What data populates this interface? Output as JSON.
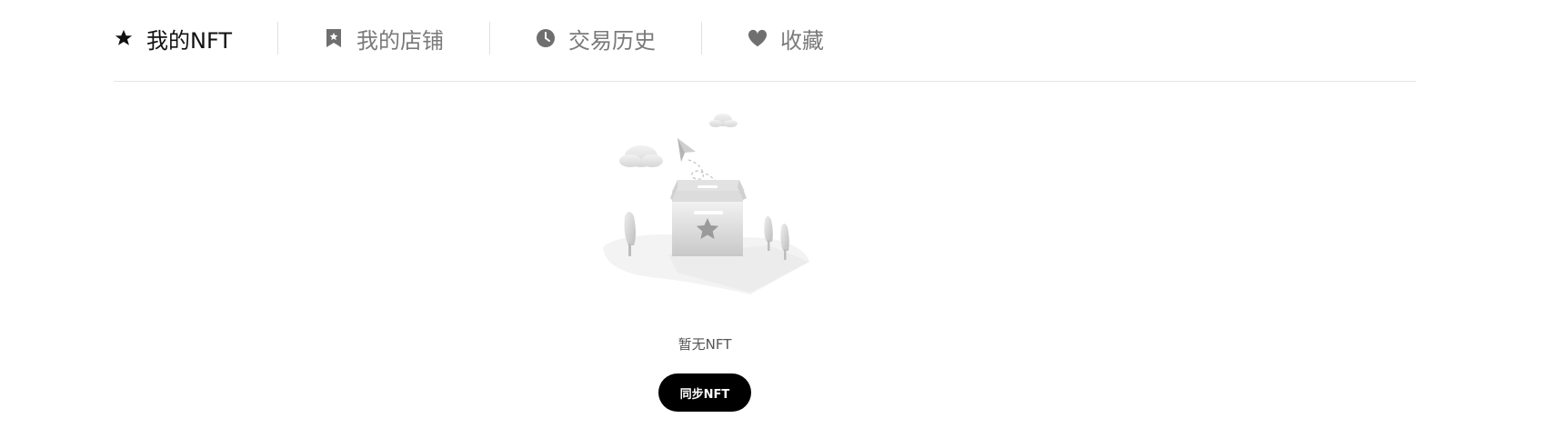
{
  "tabs": [
    {
      "label": "我的NFT",
      "icon": "star-icon",
      "active": true
    },
    {
      "label": "我的店铺",
      "icon": "bookmark-icon",
      "active": false
    },
    {
      "label": "交易历史",
      "icon": "clock-icon",
      "active": false
    },
    {
      "label": "收藏",
      "icon": "heart-icon",
      "active": false
    }
  ],
  "empty_state": {
    "message": "暂无NFT",
    "illustration": "empty-box-illustration"
  },
  "sync_button": {
    "label": "同步NFT"
  },
  "colors": {
    "active_tab": "#111111",
    "inactive_tab": "#7a7a7a",
    "button_bg": "#000000",
    "button_text": "#ffffff",
    "divider": "#e6e6e6"
  }
}
